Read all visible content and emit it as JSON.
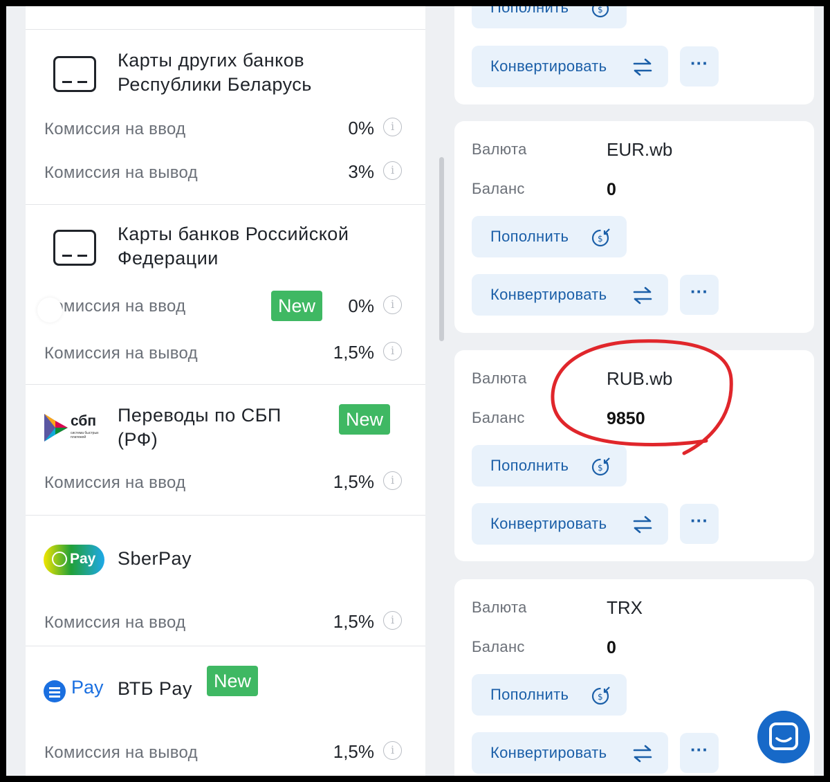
{
  "methods": [
    {
      "title": "Карты других банков Республики Беларусь",
      "rows": [
        {
          "label": "Комиссия на ввод",
          "value": "0%"
        },
        {
          "label": "Комиссия на вывод",
          "value": "3%"
        }
      ]
    },
    {
      "title": "Карты банков Российской Федерации",
      "badge": "New",
      "rows": [
        {
          "label": "Комиссия на ввод",
          "value": "0%"
        },
        {
          "label": "Комиссия на вывод",
          "value": "1,5%"
        }
      ]
    },
    {
      "title": "Переводы по СБП (РФ)",
      "badge": "New",
      "logo_text": "сбп",
      "logo_sub": "система быстрых платежей",
      "rows": [
        {
          "label": "Комиссия на ввод",
          "value": "1,5%"
        }
      ]
    },
    {
      "title": "SberPay",
      "logo_text": "Pay",
      "rows": [
        {
          "label": "Комиссия на ввод",
          "value": "1,5%"
        }
      ]
    },
    {
      "title": "ВТБ Pay",
      "badge": "New",
      "logo_text": "Pay",
      "rows": [
        {
          "label": "Комиссия на вывод",
          "value": "1,5%"
        }
      ]
    }
  ],
  "info_glyph": "i",
  "accounts": {
    "labels": {
      "currency": "Валюта",
      "balance": "Баланс",
      "deposit": "Пополнить",
      "convert": "Конвертировать",
      "more": "···"
    },
    "items": [
      {
        "currency": "EUR.wb",
        "balance": "0"
      },
      {
        "currency": "RUB.wb",
        "balance": "9850"
      },
      {
        "currency": "TRX",
        "balance": "0"
      }
    ]
  },
  "colors": {
    "accent": "#1b5fa8",
    "button_bg": "#e9f2fb",
    "badge": "#3fb863",
    "highlight": "#e0262b",
    "chat": "#1769c8"
  }
}
